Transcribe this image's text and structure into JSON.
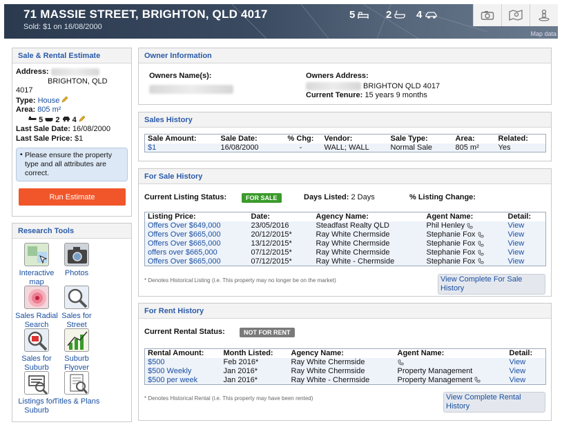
{
  "header": {
    "address": "71 MASSIE STREET, BRIGHTON, QLD 4017",
    "sold": "Sold: $1 on 16/08/2000",
    "beds": "5",
    "baths": "2",
    "cars": "4",
    "map_data": "Map data"
  },
  "estimate": {
    "title": "Sale & Rental Estimate",
    "address_label": "Address:",
    "address_suffix": "BRIGHTON, QLD",
    "postcode": "4017",
    "type_label": "Type:",
    "type_value": "House",
    "area_label": "Area:",
    "area_value": "805 m²",
    "beds": "5",
    "baths": "2",
    "cars": "4",
    "last_sale_date_label": "Last Sale Date:",
    "last_sale_date": "16/08/2000",
    "last_sale_price_label": "Last Sale Price:",
    "last_sale_price": "$1",
    "notice": "Please ensure the property type and all attributes are correct.",
    "run_button": "Run Estimate"
  },
  "research": {
    "title": "Research Tools",
    "tools": [
      {
        "label": "Interactive map"
      },
      {
        "label": "Photos"
      },
      {
        "label": "Sales Radial Search"
      },
      {
        "label": "Sales for Street"
      },
      {
        "label": "Sales for Suburb"
      },
      {
        "label": "Suburb Flyover"
      },
      {
        "label": "Listings for Suburb"
      },
      {
        "label": "Titles & Plans"
      }
    ]
  },
  "owner": {
    "title": "Owner Information",
    "names_label": "Owners Name(s):",
    "address_label": "Owners Address:",
    "address_value": "BRIGHTON QLD 4017",
    "tenure_label": "Current Tenure:",
    "tenure_value": "15 years 9 months"
  },
  "sales_history": {
    "title": "Sales History",
    "columns": [
      "Sale Amount:",
      "Sale Date:",
      "% Chg:",
      "Vendor:",
      "Sale Type:",
      "Area:",
      "Related:"
    ],
    "row": [
      "$1",
      "16/08/2000",
      "-",
      "WALL; WALL",
      "Normal Sale",
      "805 m²",
      "Yes"
    ]
  },
  "for_sale": {
    "title": "For Sale History",
    "status_label": "Current Listing Status:",
    "status_badge": "FOR SALE",
    "days_label": "Days Listed:",
    "days_value": "2 Days",
    "change_label": "% Listing Change:",
    "columns": [
      "Listing Price:",
      "Date:",
      "Agency Name:",
      "Agent Name:",
      "Detail:"
    ],
    "rows": [
      [
        "Offers Over $649,000",
        "23/05/2016",
        "Steadfast Realty QLD",
        "Phil Henley",
        "View"
      ],
      [
        "Offers Over $665,000",
        "20/12/2015*",
        "Ray White Chermside",
        "Stephanie Fox",
        "View"
      ],
      [
        "Offers Over $665,000",
        "13/12/2015*",
        "Ray White Chermside",
        "Stephanie Fox",
        "View"
      ],
      [
        "offers over $665,000",
        "07/12/2015*",
        "Ray White Chermside",
        "Stephanie Fox",
        "View"
      ],
      [
        "Offers Over $665,000",
        "07/12/2015*",
        "Ray White - Chermside",
        "Stephanie Fox",
        "View"
      ]
    ],
    "footnote": "* Denotes Historical Listing (i.e. This property may no longer be on the market)",
    "view_complete": "View Complete For Sale History"
  },
  "for_rent": {
    "title": "For Rent History",
    "status_label": "Current Rental Status:",
    "status_badge": "NOT FOR RENT",
    "columns": [
      "Rental Amount:",
      "Month Listed:",
      "Agency Name:",
      "Agent Name:",
      "Detail:"
    ],
    "rows": [
      [
        "$500",
        "Feb 2016*",
        "Ray White Chermside",
        "",
        "View"
      ],
      [
        "$500 Weekly",
        "Jan 2016*",
        "Ray White Chermside",
        "Property Management",
        "View"
      ],
      [
        "$500 per week",
        "Jan 2016*",
        "Ray White - Chermside",
        "Property Management",
        "View"
      ]
    ],
    "footnote": "* Denotes Historical Rental (i.e. This property may have been rented)",
    "view_complete": "View Complete Rental History"
  },
  "colors": {
    "accent": "#2a5aa8",
    "run_button": "#f0562a",
    "for_sale_badge": "#3a9a2a",
    "not_for_rent_badge": "#7a7a7a"
  }
}
